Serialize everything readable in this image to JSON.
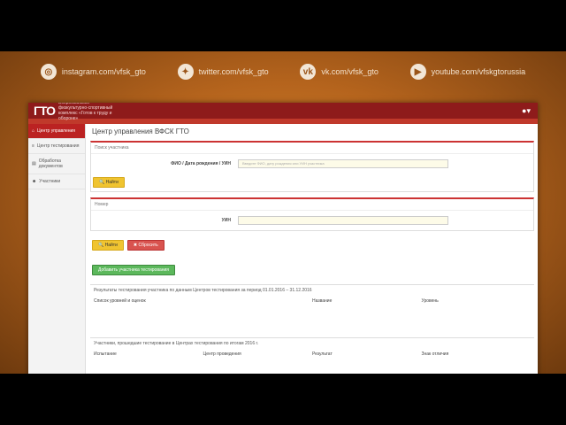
{
  "social": [
    {
      "icon": "instagram-icon",
      "glyph": "◎",
      "label": "instagram.com/vfsk_gto"
    },
    {
      "icon": "twitter-icon",
      "glyph": "✦",
      "label": "twitter.com/vfsk_gto"
    },
    {
      "icon": "vk-icon",
      "glyph": "vk",
      "label": "vk.com/vfsk_gto"
    },
    {
      "icon": "youtube-icon",
      "glyph": "▶",
      "label": "youtube.com/vfskgtorussia"
    }
  ],
  "app": {
    "logo": "ГТО",
    "logo_subtitle": "Всероссийский физкультурно-спортивный комплекс «Готов к труду и обороне»",
    "page_title": "Центр управления ВФСК ГТО"
  },
  "sidebar": {
    "items": [
      {
        "label": "Центр управления",
        "active": true
      },
      {
        "label": "Центр тестирования",
        "active": false
      },
      {
        "label": "Обработка документов",
        "active": false
      },
      {
        "label": "Участники",
        "active": false
      }
    ]
  },
  "panel1": {
    "head": "Поиск участника",
    "field_label": "ФИО / Дата рождения / УИН",
    "field_placeholder": "Введите ФИО, дату рождения или УИН участника",
    "button": "Найти"
  },
  "panel2": {
    "head": "Номер",
    "field_label": "УИН",
    "field_value": "",
    "btn_search": "Найти",
    "btn_reset": "Сбросить"
  },
  "add_button": "Добавить участника тестирования",
  "table1": {
    "caption": "Результаты тестирования участника по данным Центров тестирования за период 01.01.2016 – 31.12.2016",
    "headers": [
      "Список уровней и оценок",
      "",
      "Название",
      "Уровень"
    ]
  },
  "table2": {
    "caption": "Участники, прошедшие тестирование в Центрах тестирования по итогам 2016 г.",
    "headers": [
      "Испытание",
      "Центр проведения",
      "Результат",
      "Знак отличия"
    ]
  }
}
